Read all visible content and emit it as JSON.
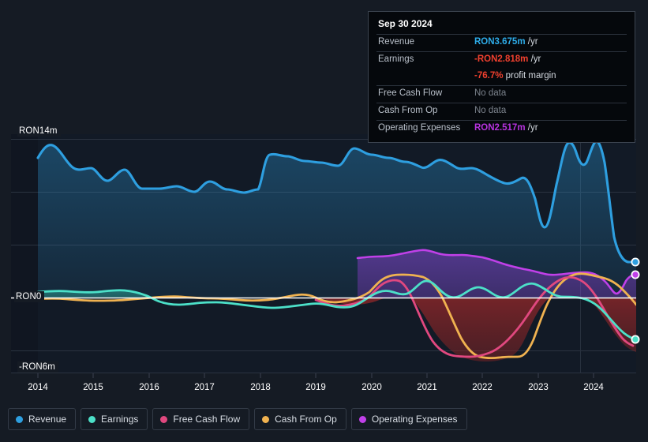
{
  "theme": {
    "background": "#151b24",
    "plot_background": "#101621",
    "grid_color": "#2b3340",
    "zero_line_color": "#ffffff",
    "text_color": "#ffffff"
  },
  "series_colors": {
    "revenue": "#2e9fe0",
    "earnings": "#4ce0c8",
    "free_cash_flow": "#e0487f",
    "cash_from_op": "#f0b250",
    "operating_expenses": "#c040e8"
  },
  "tooltip": {
    "date": "Sep 30 2024",
    "rows": [
      {
        "key": "Revenue",
        "value": "RON3.675m",
        "unit": "/yr",
        "color": "#2eadea",
        "no_data": false
      },
      {
        "key": "Earnings",
        "value": "-RON2.818m",
        "unit": "/yr",
        "color": "#f0402e",
        "no_data": false
      },
      {
        "key": "",
        "value": "-76.7%",
        "unit": "profit margin",
        "color": "#f0402e",
        "no_data": false
      },
      {
        "key": "Free Cash Flow",
        "value": "No data",
        "unit": "",
        "color": "#7c838d",
        "no_data": true
      },
      {
        "key": "Cash From Op",
        "value": "No data",
        "unit": "",
        "color": "#7c838d",
        "no_data": true
      },
      {
        "key": "Operating Expenses",
        "value": "RON2.517m",
        "unit": "/yr",
        "color": "#b833e0",
        "no_data": false
      }
    ]
  },
  "legend": {
    "items": [
      {
        "label": "Revenue",
        "color": "#2e9fe0"
      },
      {
        "label": "Earnings",
        "color": "#4ce0c8"
      },
      {
        "label": "Free Cash Flow",
        "color": "#e0487f"
      },
      {
        "label": "Cash From Op",
        "color": "#f0b250"
      },
      {
        "label": "Operating Expenses",
        "color": "#c040e8"
      }
    ]
  },
  "axes": {
    "y_labels": {
      "top": "RON14m",
      "zero": "RON0",
      "bottom": "-RON6m"
    },
    "x_labels": [
      "2014",
      "2015",
      "2016",
      "2017",
      "2018",
      "2019",
      "2020",
      "2021",
      "2022",
      "2023",
      "2024"
    ]
  },
  "chart_data": {
    "type": "area",
    "title": "",
    "subtitle": "",
    "xlabel": "",
    "ylabel": "RON (millions)",
    "currency": "RON",
    "units": "millions",
    "grid": true,
    "legend_position": "bottom",
    "ylim": [
      -6,
      14
    ],
    "xlim": [
      "2014",
      "2024-Q4"
    ],
    "y_ticks": [
      14,
      0,
      -6
    ],
    "y_tick_labels": [
      "RON14m",
      "RON0",
      "-RON6m"
    ],
    "x_ticks": [
      "2014",
      "2015",
      "2016",
      "2017",
      "2018",
      "2019",
      "2020",
      "2021",
      "2022",
      "2023",
      "2024"
    ],
    "zero_line": 0,
    "highlight_divider_x": "2023-Q3",
    "x": [
      "2014.0",
      "2014.25",
      "2014.5",
      "2014.75",
      "2015.0",
      "2015.25",
      "2015.5",
      "2015.75",
      "2016.0",
      "2016.25",
      "2016.5",
      "2016.75",
      "2017.0",
      "2017.25",
      "2017.5",
      "2017.75",
      "2018.0",
      "2018.25",
      "2018.5",
      "2018.75",
      "2019.0",
      "2019.25",
      "2019.5",
      "2019.75",
      "2020.0",
      "2020.25",
      "2020.5",
      "2020.75",
      "2021.0",
      "2021.25",
      "2021.5",
      "2021.75",
      "2022.0",
      "2022.25",
      "2022.5",
      "2022.75",
      "2023.0",
      "2023.25",
      "2023.5",
      "2023.75",
      "2024.0",
      "2024.25",
      "2024.5",
      "2024.75"
    ],
    "series": [
      {
        "name": "Revenue",
        "color": "#2e9fe0",
        "endpoint_value": 3.675,
        "values": [
          11.3,
          12.5,
          11.4,
          10.7,
          10.6,
          10.0,
          10.3,
          10.7,
          9.9,
          9.6,
          9.0,
          8.9,
          8.9,
          9.0,
          9.1,
          8.9,
          11.0,
          11.4,
          11.2,
          11.0,
          10.8,
          10.7,
          11.6,
          12.1,
          11.5,
          11.3,
          11.2,
          10.9,
          10.7,
          10.2,
          9.7,
          9.6,
          9.5,
          10.1,
          10.3,
          9.9,
          8.6,
          6.3,
          9.6,
          12.8,
          11.5,
          13.1,
          9.0,
          3.675
        ]
      },
      {
        "name": "Earnings",
        "color": "#4ce0c8",
        "endpoint_value": -2.818,
        "values": [
          0.55,
          0.6,
          0.6,
          0.62,
          0.58,
          0.6,
          0.62,
          0.6,
          0.55,
          0.1,
          -0.15,
          -0.18,
          -0.15,
          -0.1,
          -0.05,
          0.0,
          0.05,
          0.05,
          0.0,
          -0.1,
          -0.2,
          -0.25,
          -0.3,
          -0.2,
          0.05,
          0.35,
          0.5,
          0.45,
          0.3,
          0.25,
          0.35,
          0.45,
          0.3,
          0.25,
          0.2,
          0.15,
          0.2,
          0.25,
          0.2,
          0.1,
          0.0,
          -0.3,
          -1.6,
          -2.818
        ]
      },
      {
        "name": "Free Cash Flow",
        "color": "#e0487f",
        "endpoint_value": null,
        "values": [
          null,
          null,
          null,
          null,
          null,
          null,
          null,
          null,
          null,
          null,
          null,
          null,
          null,
          null,
          null,
          null,
          null,
          null,
          null,
          null,
          -0.1,
          -0.25,
          -0.3,
          -0.25,
          -0.2,
          0.6,
          1.6,
          1.3,
          0.1,
          -1.6,
          -3.2,
          -4.2,
          -4.6,
          -4.7,
          -4.6,
          -3.0,
          -0.2,
          1.5,
          1.8,
          1.4,
          0.2,
          -1.8,
          -3.6,
          null
        ]
      },
      {
        "name": "Cash From Op",
        "color": "#f0b250",
        "endpoint_value": null,
        "values": [
          0.2,
          0.22,
          0.2,
          0.18,
          0.15,
          0.12,
          0.1,
          0.08,
          0.05,
          0.0,
          -0.05,
          -0.08,
          -0.05,
          0.0,
          0.05,
          0.1,
          0.2,
          0.3,
          0.35,
          0.3,
          0.2,
          0.1,
          0.0,
          -0.05,
          0.1,
          1.2,
          2.2,
          2.3,
          2.2,
          0.9,
          -1.2,
          -3.6,
          -4.9,
          -5.0,
          -4.9,
          -4.9,
          -3.2,
          1.4,
          2.3,
          2.4,
          2.4,
          2.2,
          0.5,
          null
        ]
      },
      {
        "name": "Operating Expenses",
        "color": "#c040e8",
        "endpoint_value": 2.517,
        "values": [
          null,
          null,
          null,
          null,
          null,
          null,
          null,
          null,
          null,
          null,
          null,
          null,
          null,
          null,
          null,
          null,
          null,
          null,
          null,
          null,
          null,
          null,
          null,
          null,
          3.3,
          3.4,
          3.4,
          3.5,
          3.7,
          3.8,
          4.0,
          3.9,
          3.8,
          3.9,
          3.8,
          3.4,
          3.2,
          3.0,
          3.3,
          3.4,
          3.3,
          2.0,
          0.9,
          2.517
        ]
      }
    ]
  }
}
